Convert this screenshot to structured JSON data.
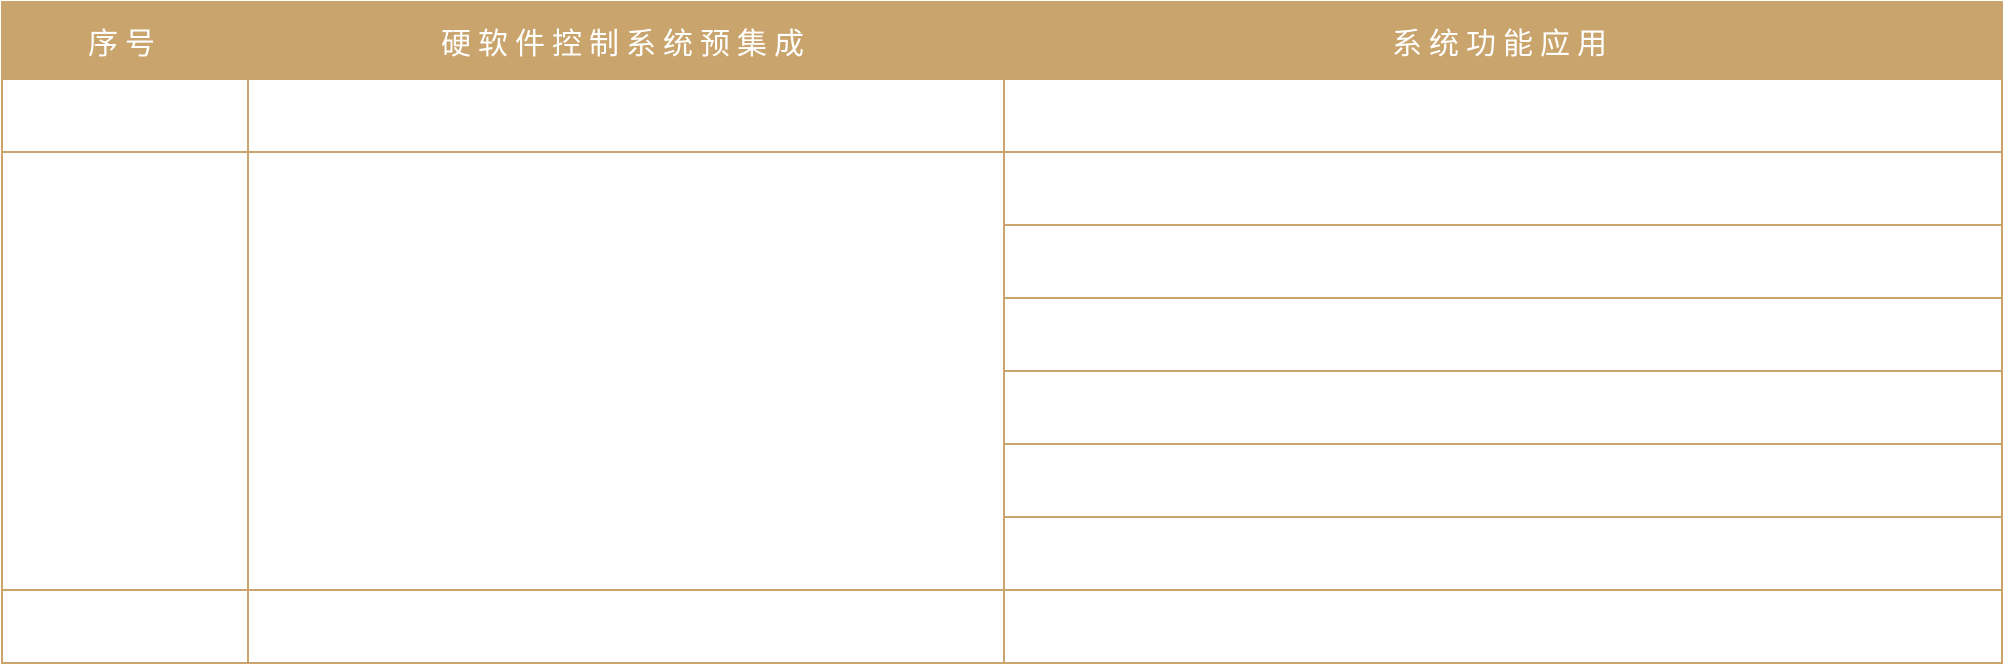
{
  "table": {
    "headers": [
      "序号",
      "硬软件控制系统预集成",
      "系统功能应用"
    ],
    "accent_color": "#c9a46c"
  }
}
